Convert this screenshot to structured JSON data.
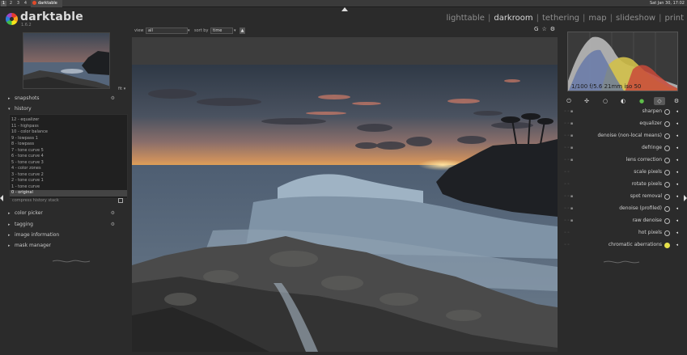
{
  "taskbar": {
    "workspaces": [
      "1",
      "2",
      "3",
      "4"
    ],
    "active_task": "darktable",
    "clock": "Sat Jan 30, 17:02"
  },
  "header": {
    "brand": "darktable",
    "version": "1.6.2",
    "views": [
      "lighttable",
      "darkroom",
      "tethering",
      "map",
      "slideshow",
      "print"
    ],
    "current_view": "darkroom"
  },
  "filter": {
    "view_label": "view",
    "view_value": "all",
    "sort_label": "sort by",
    "sort_value": "time",
    "sort_dir_icon": "▲"
  },
  "toolbar_right": {
    "icons": [
      "G",
      "☆",
      "⚙"
    ]
  },
  "left_panel": {
    "snapshots": {
      "label": "snapshots",
      "arrow": "▸",
      "icon": "⚙"
    },
    "history": {
      "label": "history",
      "arrow": "▾",
      "items": [
        "12 - equalizer",
        "11 - highpass",
        "10 - color balance",
        "9 - lowpass 1",
        "8 - lowpass",
        "7 - tone curve 5",
        "6 - tone curve 4",
        "5 - tone curve 3",
        "4 - color zones",
        "3 - tone curve 2",
        "2 - tone curve 1",
        "1 - tone curve",
        "0 - original"
      ],
      "compress_label": "compress history stack"
    },
    "sections": [
      {
        "label": "color picker",
        "arrow": "▸",
        "icon": "⚙"
      },
      {
        "label": "tagging",
        "arrow": "▸",
        "icon": "⚙"
      },
      {
        "label": "image information",
        "arrow": "▸",
        "icon": ""
      },
      {
        "label": "mask manager",
        "arrow": "▸",
        "icon": ""
      }
    ]
  },
  "navigation": {
    "zoom_label": "fit ▾"
  },
  "right_panel": {
    "exif": "1/100 f/5.6 21mm iso 50",
    "group_icons": [
      "⏻",
      "✣",
      "○",
      "◐",
      "●",
      "◇",
      "⚙"
    ],
    "modules": [
      {
        "name": "sharpen",
        "icon": "sharpen-icon"
      },
      {
        "name": "equalizer",
        "icon": "equalizer-icon"
      },
      {
        "name": "denoise (non-local means)",
        "icon": "denoise-icon"
      },
      {
        "name": "defringe",
        "icon": "defringe-icon"
      },
      {
        "name": "lens correction",
        "icon": "lens-icon"
      },
      {
        "name": "scale pixels",
        "icon": "scale-icon"
      },
      {
        "name": "rotate pixels",
        "icon": "rotate-icon"
      },
      {
        "name": "spot removal",
        "icon": "spot-icon"
      },
      {
        "name": "denoise (profiled)",
        "icon": "denoise-profiled-icon"
      },
      {
        "name": "raw denoise",
        "icon": "raw-denoise-icon"
      },
      {
        "name": "hot pixels",
        "icon": "hot-pixels-icon"
      },
      {
        "name": "chromatic aberrations",
        "icon": "chromatic-icon"
      }
    ]
  },
  "colors": {
    "background": "#2b2b2b",
    "accent_active": "#d9d9d9",
    "history_selected": "#444444"
  }
}
